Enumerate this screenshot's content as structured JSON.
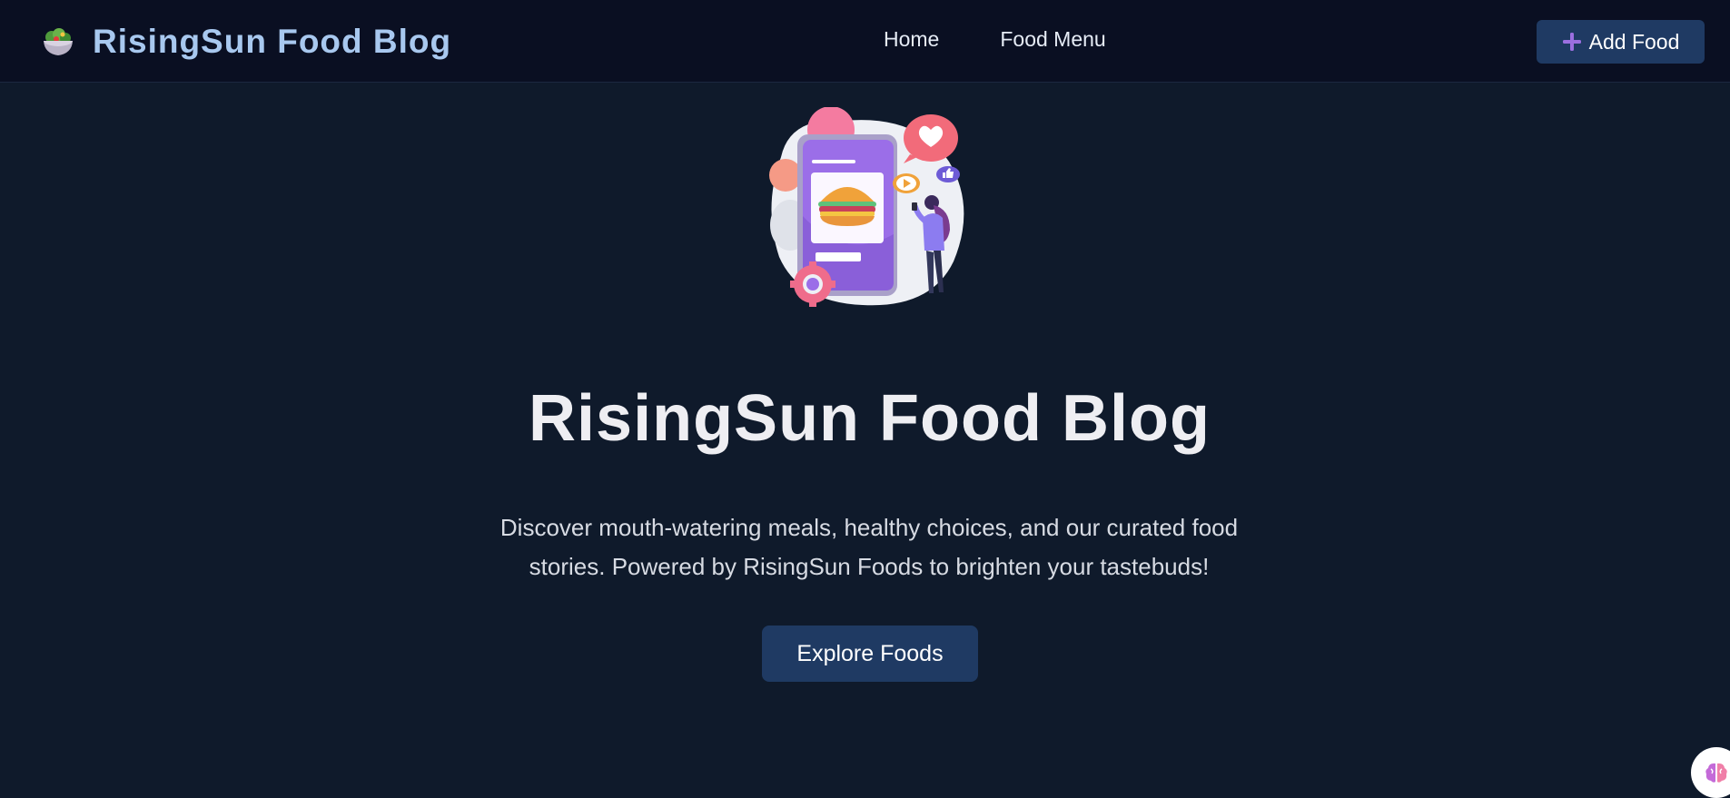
{
  "navbar": {
    "brand_icon": "salad-bowl-icon",
    "brand_title": "RisingSun Food Blog",
    "links": [
      {
        "label": "Home"
      },
      {
        "label": "Food Menu"
      }
    ],
    "add_button": {
      "icon": "plus-icon",
      "label": "Add Food"
    }
  },
  "hero": {
    "illustration": "phone-burger-illustration",
    "title": "RisingSun Food Blog",
    "description": "Discover mouth-watering meals, healthy choices, and our curated food stories. Powered by RisingSun Foods to brighten your tastebuds!",
    "cta_label": "Explore Foods"
  },
  "assistant": {
    "icon": "brain-icon"
  },
  "colors": {
    "background": "#0f1a2b",
    "navbar": "#0a0f22",
    "brand_text": "#a8c8ef",
    "button": "#1f3a63"
  }
}
